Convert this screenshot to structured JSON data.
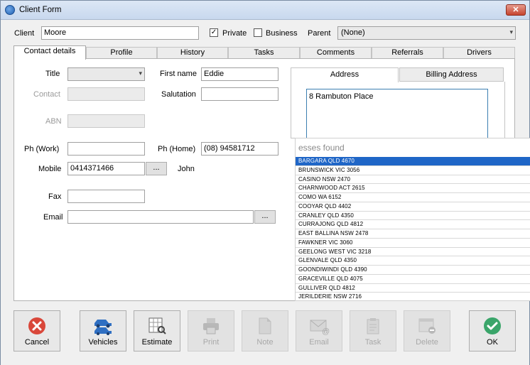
{
  "window": {
    "title": "Client Form",
    "close_label": "✕"
  },
  "top": {
    "client_label": "Client",
    "client_value": "Moore",
    "private_label": "Private",
    "private_checked": true,
    "business_label": "Business",
    "business_checked": false,
    "parent_label": "Parent",
    "parent_value": "(None)"
  },
  "tabs": [
    "Contact details",
    "Profile",
    "History",
    "Tasks",
    "Comments",
    "Referrals",
    "Drivers"
  ],
  "contact": {
    "title_label": "Title",
    "title_value": "",
    "firstname_label": "First name",
    "firstname_value": "Eddie",
    "contact_label": "Contact",
    "salutation_label": "Salutation",
    "salutation_value": "",
    "abn_label": "ABN",
    "phwork_label": "Ph (Work)",
    "phwork_value": "",
    "phhome_label": "Ph (Home)",
    "phhome_value": "(08) 94581712",
    "mobile_label": "Mobile",
    "mobile_value": "0414371466",
    "mobile_btn": "...",
    "mobile_name": "John",
    "fax_label": "Fax",
    "fax_value": "",
    "email_label": "Email",
    "email_value": "",
    "email_btn": "..."
  },
  "address": {
    "tabs": [
      "Address",
      "Billing Address"
    ],
    "value": "8 Rambuton Place"
  },
  "suggestions": {
    "header": "esses found",
    "items": [
      "BARGARA QLD 4670",
      "BRUNSWICK VIC 3056",
      "CASINO NSW 2470",
      "CHARNWOOD ACT 2615",
      "COMO WA 6152",
      "COOYAR QLD 4402",
      "CRANLEY QLD 4350",
      "CURRAJONG QLD 4812",
      "EAST BALLINA NSW 2478",
      "FAWKNER VIC 3060",
      "GEELONG WEST VIC 3218",
      "GLENVALE QLD 4350",
      "GOONDIWINDI QLD 4390",
      "GRACEVILLE QLD 4075",
      "GULLIVER QLD 4812",
      "JERILDERIE NSW 2716"
    ],
    "selected_index": 0
  },
  "buttons": {
    "cancel": "Cancel",
    "vehicles": "Vehicles",
    "estimate": "Estimate",
    "print": "Print",
    "note": "Note",
    "email": "Email",
    "task": "Task",
    "delete": "Delete",
    "ok": "OK"
  },
  "colors": {
    "cancel_red": "#d9473a",
    "ok_green": "#3aa56a",
    "selection_blue": "#1f66c7"
  }
}
